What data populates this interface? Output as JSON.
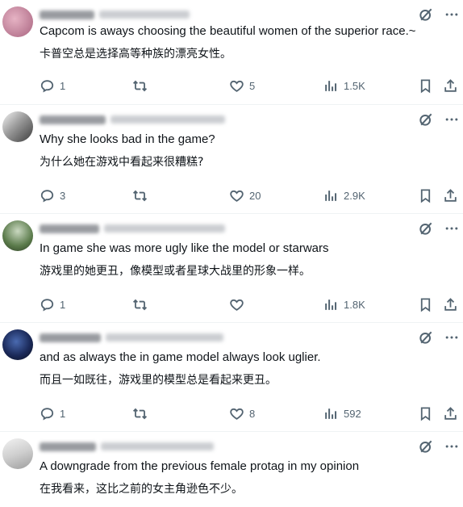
{
  "colors": {
    "icon": "#536471",
    "text": "#0f1419",
    "divider": "#eff3f4"
  },
  "icons": [
    "reply-icon",
    "retweet-icon",
    "heart-icon",
    "views-icon",
    "bookmark-icon",
    "share-icon",
    "grok-icon",
    "more-icon"
  ],
  "tweets": [
    {
      "line1": "Capcom is aways choosing the beautiful women of the superior race.~",
      "line2": "卡普空总是选择高等种族的漂亮女性。",
      "replies": "1",
      "retweets": "",
      "likes": "5",
      "views": "1.5K",
      "avatar_color": "#c98aa3"
    },
    {
      "line1": "Why she looks bad in the game?",
      "line2": "为什么她在游戏中看起来很糟糕?",
      "replies": "3",
      "retweets": "",
      "likes": "20",
      "views": "2.9K",
      "avatar_color": "#8a8a8a"
    },
    {
      "line1": "In game she was more ugly like the model or starwars",
      "line2": "游戏里的她更丑，像模型或者星球大战里的形象一样。",
      "replies": "1",
      "retweets": "",
      "likes": "",
      "views": "1.8K",
      "avatar_color": "#5a7a4a"
    },
    {
      "line1": "and as always the in game model always look uglier.",
      "line2": "而且一如既往，游戏里的模型总是看起来更丑。",
      "replies": "1",
      "retweets": "",
      "likes": "8",
      "views": "592",
      "avatar_color": "#1b2a5a"
    },
    {
      "line1": "A downgrade from the previous female protag in my opinion",
      "line2": "在我看来，这比之前的女主角逊色不少。",
      "replies": "",
      "retweets": "",
      "likes": "",
      "views": "",
      "avatar_color": "#d8d8d8"
    }
  ]
}
